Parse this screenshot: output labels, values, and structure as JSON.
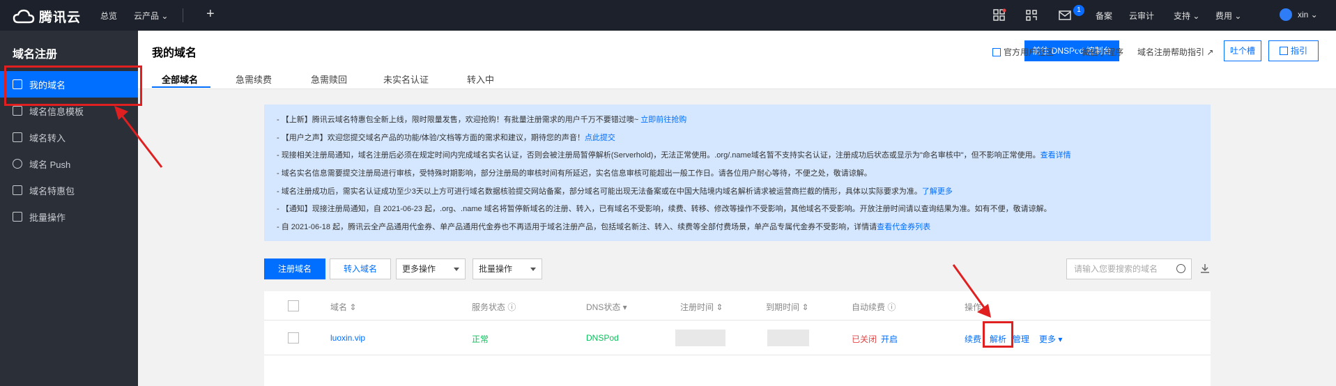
{
  "topbar": {
    "brand": "腾讯云",
    "nav_overview": "总览",
    "nav_products": "云产品",
    "plus": "+",
    "notification_count": "1",
    "links": [
      "备案",
      "云审计",
      "支持",
      "费用"
    ],
    "user": "xin"
  },
  "sidebar": {
    "title": "域名注册",
    "items": [
      {
        "label": "我的域名",
        "icon": "domain-icon"
      },
      {
        "label": "域名信息模板",
        "icon": "template-icon"
      },
      {
        "label": "域名转入",
        "icon": "transfer-icon"
      },
      {
        "label": "域名 Push",
        "icon": "push-icon"
      },
      {
        "label": "域名特惠包",
        "icon": "package-icon"
      },
      {
        "label": "批量操作",
        "icon": "batch-icon"
      }
    ]
  },
  "header": {
    "title": "我的域名",
    "tabs": [
      "全部域名",
      "急需续费",
      "急需赎回",
      "未实名认证",
      "转入中"
    ],
    "dnspod_button": "前往 DNSPod 控制台",
    "community": "官方用户社区",
    "miniprogram": "微信小程序",
    "help": "域名注册帮助指引",
    "feedback": "吐个槽",
    "guide": "指引"
  },
  "notice": {
    "lines": [
      {
        "text": "- 【上新】腾讯云域名特惠包全新上线，限时限量发售，欢迎抢购！有批量注册需求的用户千万不要错过噢~ ",
        "link": "立即前往抢购"
      },
      {
        "text": "- 【用户之声】欢迎您提交域名产品的功能/体验/文档等方面的需求和建议，期待您的声音！",
        "link": "点此提交"
      },
      {
        "text": "- 现接相关注册局通知，域名注册后必须在规定时间内完成域名实名认证，否则会被注册局暂停解析(Serverhold)，无法正常使用。.org/.name域名暂不支持实名认证，注册成功后状态或显示为\"命名审核中\"，但不影响正常使用。",
        "link": "查看详情"
      },
      {
        "text": "- 域名实名信息需要提交注册局进行审核，受特殊时期影响，部分注册局的审核时间有所延迟，实名信息审核可能超出一般工作日。请各位用户耐心等待，不便之处，敬请谅解。",
        "link": ""
      },
      {
        "text": "- 域名注册成功后，需实名认证成功至少3天以上方可进行域名数据核验提交网站备案，部分域名可能出现无法备案或在中国大陆境内域名解析请求被运营商拦截的情形，具体以实际要求为准。",
        "link": "了解更多"
      },
      {
        "text": "- 【通知】现接注册局通知，自 2021-06-23 起，.org、.name 域名将暂停新域名的注册、转入，已有域名不受影响，续费、转移、修改等操作不受影响，其他域名不受影响。开放注册时间请以查询结果为准。如有不便，敬请谅解。",
        "link": ""
      },
      {
        "text": "- 自 2021-06-18 起，腾讯云全产品通用代金券、单产品通用代金券也不再适用于域名注册产品，包括域名新注、转入、续费等全部付费场景，单产品专属代金券不受影响，详情请",
        "link": "查看代金券列表"
      }
    ]
  },
  "toolbar": {
    "register": "注册域名",
    "transfer_in": "转入域名",
    "more_ops": "更多操作",
    "batch_ops": "批量操作",
    "search_placeholder": "请输入您要搜索的域名"
  },
  "table": {
    "columns": [
      "域名",
      "服务状态",
      "DNS状态",
      "注册时间",
      "到期时间",
      "自动续费",
      "操作"
    ],
    "rows": [
      {
        "domain": "luoxin.vip",
        "service_status": "正常",
        "dns_status": "DNSPod",
        "auto_renew": "已关闭",
        "auto_renew_action": "开启",
        "actions": [
          "续费",
          "解析",
          "管理",
          "更多"
        ]
      }
    ]
  },
  "colors": {
    "accent": "#006eff",
    "topbar": "#1c212b",
    "sidebar": "#2b2f38",
    "notice_bg": "#d5e7fe",
    "success": "#0abf5b",
    "danger": "#e54545",
    "annotation": "#e02020"
  }
}
